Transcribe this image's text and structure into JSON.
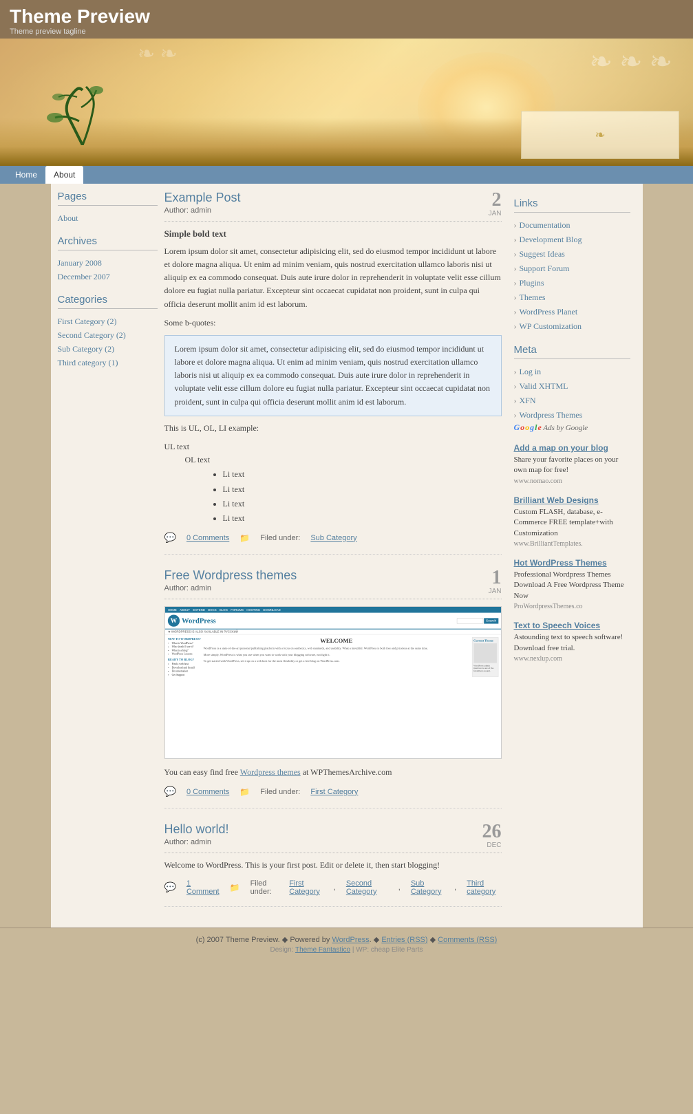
{
  "site": {
    "title": "Theme Preview",
    "tagline": "Theme preview tagline"
  },
  "nav": {
    "items": [
      {
        "label": "Home",
        "active": false
      },
      {
        "label": "About",
        "active": true
      }
    ]
  },
  "posts": [
    {
      "id": "post-1",
      "title": "Example Post",
      "author": "Author: admin",
      "date_num": "2",
      "date_month": "JAN",
      "subtitle": "Simple bold text",
      "body_para": "Lorem ipsum dolor sit amet, consectetur adipisicing elit, sed do eiusmod tempor incididunt ut labore et dolore magna aliqua. Ut enim ad minim veniam, quis nostrud exercitation ullamco laboris nisi ut aliquip ex ea commodo consequat. Duis aute irure dolor in reprehenderit in voluptate velit esse cillum dolore eu fugiat nulla pariatur. Excepteur sint occaecat cupidatat non proident, sunt in culpa qui officia deserunt mollit anim id est laborum.",
      "bquote_label": "Some b-quotes:",
      "blockquote": "Lorem ipsum dolor sit amet, consectetur adipisicing elit, sed do eiusmod tempor incididunt ut labore et dolore magna aliqua. Ut enim ad minim veniam, quis nostrud exercitation ullamco laboris nisi ut aliquip ex ea commodo consequat. Duis aute irure dolor in reprehenderit in voluptate velit esse cillum dolore eu fugiat nulla pariatur. Excepteur sint occaecat cupidatat non proident, sunt in culpa qui officia deserunt mollit anim id est laborum.",
      "list_label": "This is UL, OL, LI example:",
      "ul_text": "UL text",
      "ol_text": "OL text",
      "li_items": [
        "Li text",
        "Li text",
        "Li text",
        "Li text"
      ],
      "comments": "0 Comments",
      "filed_label": "Filed under:",
      "filed_cat": "Sub Category"
    },
    {
      "id": "post-2",
      "title": "Free Wordpress themes",
      "author": "Author: admin",
      "date_num": "1",
      "date_month": "JAN",
      "body_text": "You can easy find free ",
      "body_link": "Wordpress themes",
      "body_text2": " at WPThemesArchive.com",
      "comments": "0 Comments",
      "filed_label": "Filed under:",
      "filed_cat": "First Category"
    },
    {
      "id": "post-3",
      "title": "Hello world!",
      "author": "Author: admin",
      "date_num": "26",
      "date_month": "DEC",
      "body": "Welcome to WordPress. This is your first post. Edit or delete it, then start blogging!",
      "comments": "1 Comment",
      "filed_label": "Filed under:",
      "filed_cats": [
        "First Category",
        "Second Category",
        "Sub Category",
        "Third category"
      ]
    }
  ],
  "sidebar": {
    "pages_title": "Pages",
    "pages": [
      {
        "label": "About"
      }
    ],
    "archives_title": "Archives",
    "archives": [
      {
        "label": "January 2008"
      },
      {
        "label": "December 2007"
      }
    ],
    "categories_title": "Categories",
    "categories": [
      {
        "label": "First Category (2)"
      },
      {
        "label": "Second Category (2)"
      },
      {
        "label": "Sub Category (2)"
      },
      {
        "label": "Third category (1)"
      }
    ]
  },
  "right_sidebar": {
    "links_title": "Links",
    "links": [
      {
        "label": "Documentation"
      },
      {
        "label": "Development Blog"
      },
      {
        "label": "Suggest Ideas"
      },
      {
        "label": "Support Forum"
      },
      {
        "label": "Plugins"
      },
      {
        "label": "Themes"
      },
      {
        "label": "WordPress Planet"
      },
      {
        "label": "WP Customization"
      }
    ],
    "meta_title": "Meta",
    "meta": [
      {
        "label": "Log in"
      },
      {
        "label": "Valid XHTML"
      },
      {
        "label": "XFN"
      },
      {
        "label": "Wordpress Themes"
      }
    ],
    "ads_label": "Ads by Google",
    "ads": [
      {
        "title": "Add a map on your blog",
        "desc": "Share your favorite places on your own map for free!",
        "url": "www.nomao.com"
      },
      {
        "title": "Brilliant Web Designs",
        "desc": "Custom FLASH, database, e-Commerce FREE template+with Customization",
        "url": "www.BrilliantTemplates."
      },
      {
        "title": "Hot WordPress Themes",
        "desc": "Professional Wordpress Themes Download A Free Wordpress Theme Now",
        "url": "ProWordpressThemes.co"
      },
      {
        "title": "Text to Speech Voices",
        "desc": "Astounding text to speech software! Download free trial.",
        "url": "www.nexlup.com"
      }
    ]
  },
  "footer": {
    "copyright": "(c) 2007 Theme Preview.",
    "powered": "Powered by",
    "wp_link": "WordPress",
    "entries_rss": "Entries (RSS)",
    "comments_rss": "Comments (RSS)",
    "design_label": "Design:",
    "design_link": "Theme Fantastico",
    "wp_themes": "WP: cheap Elite Parts"
  },
  "wp_mock": {
    "nav_items": [
      "HOME",
      "ABOUT",
      "EXTEND",
      "DOCS",
      "BLOG",
      "FORUMS",
      "HOSTING",
      "DOWNLOAD"
    ],
    "welcome": "WELCOME",
    "desc1": "WordPress is a state-of-the-art personal publishing platform with a focus on aesthetics, web standards, and usability. What a mouthful. WordPress is both free and priceless at the same time.",
    "desc2": "More simply, WordPress is what you use when you want to work with your blogging software, not fight it.",
    "desc3": "To get started with WordPress, set it up on a web host for the most flexibility or get a free blog on WordPress.com.",
    "new_title": "NEW TO WORDPRESS?",
    "new_items": [
      "What is WordPress?",
      "Why should I use it?",
      "What is a blog?",
      "WordPress Lessons"
    ],
    "ready_title": "READY TO BLOG?",
    "ready_items": [
      "Find a web host",
      "Download and Install",
      "Documentation",
      "Get Support"
    ],
    "sidebar_title": "Current Theme"
  }
}
